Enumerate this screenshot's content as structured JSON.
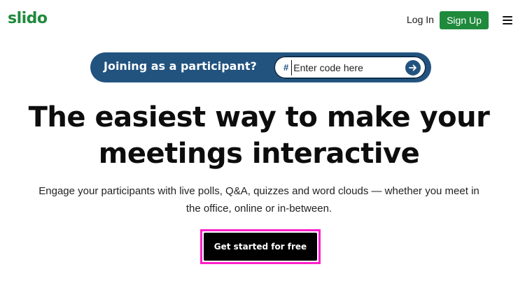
{
  "header": {
    "logo": "slido",
    "login_label": "Log In",
    "signup_label": "Sign Up",
    "menu_icon": "hamburger-menu-icon"
  },
  "join": {
    "label": "Joining as a participant?",
    "hash": "#",
    "placeholder": "Enter code here",
    "value": "",
    "submit_icon": "arrow-right-icon"
  },
  "hero": {
    "headline_line1": "The easiest way to make your",
    "headline_line2": "meetings interactive",
    "subtext_line1": "Engage your participants with live polls, Q&A, quizzes and word clouds — whether you meet in",
    "subtext_line2": "the office, online or in-between.",
    "cta_label": "Get started for free"
  },
  "colors": {
    "brand_green": "#1f8a3c",
    "join_bar_blue": "#22537f",
    "cta_black": "#000000",
    "highlight_magenta": "#ff1fc8"
  }
}
